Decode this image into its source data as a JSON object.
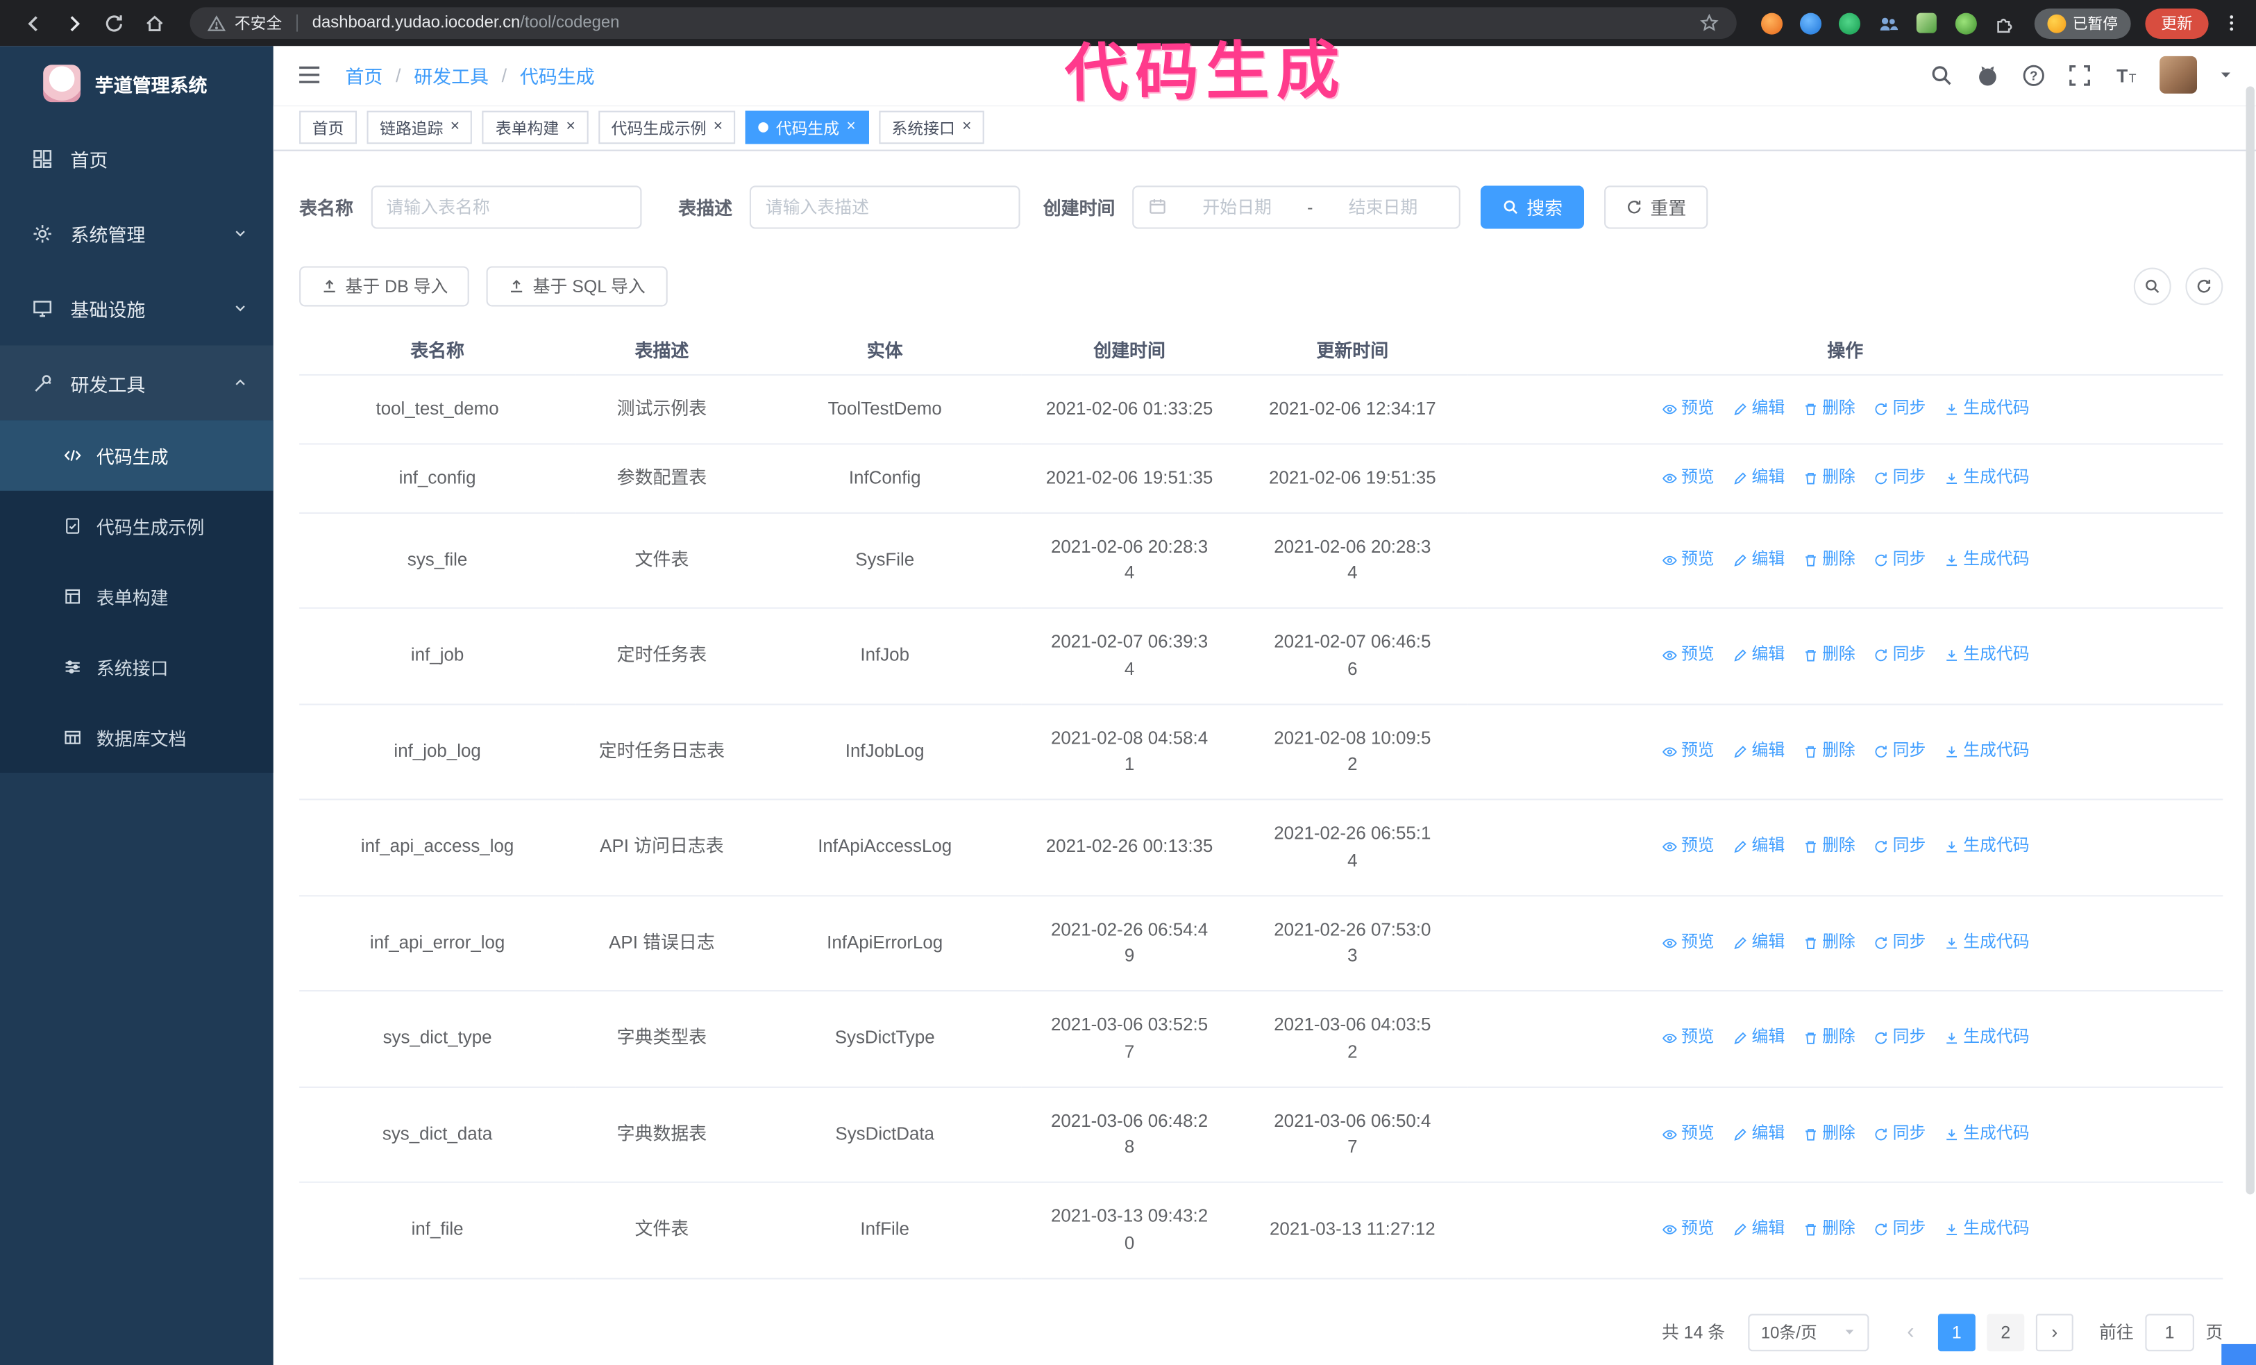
{
  "colors": {
    "accent": "#409eff",
    "annotation": "#ff3a8c",
    "sidebar_bg": "#1f3a55",
    "chrome_bg": "#202124"
  },
  "browser": {
    "security_text": "不安全",
    "url_host": "dashboard.yudao.iocoder.cn",
    "url_path": "/tool/codegen",
    "paused_badge": "已暂停",
    "update_button": "更新"
  },
  "annotation": {
    "text": "代码生成"
  },
  "sidebar": {
    "logo_title": "芋道管理系统",
    "items": [
      {
        "label": "首页"
      },
      {
        "label": "系统管理"
      },
      {
        "label": "基础设施"
      },
      {
        "label": "研发工具"
      }
    ],
    "subitems": [
      {
        "label": "代码生成"
      },
      {
        "label": "代码生成示例"
      },
      {
        "label": "表单构建"
      },
      {
        "label": "系统接口"
      },
      {
        "label": "数据库文档"
      }
    ]
  },
  "header": {
    "breadcrumb": [
      "首页",
      "研发工具",
      "代码生成"
    ]
  },
  "tabs": [
    {
      "label": "首页"
    },
    {
      "label": "链路追踪"
    },
    {
      "label": "表单构建"
    },
    {
      "label": "代码生成示例"
    },
    {
      "label": "代码生成"
    },
    {
      "label": "系统接口"
    }
  ],
  "filters": {
    "table_name_label": "表名称",
    "table_name_placeholder": "请输入表名称",
    "table_desc_label": "表描述",
    "table_desc_placeholder": "请输入表描述",
    "create_time_label": "创建时间",
    "date_start_placeholder": "开始日期",
    "date_separator": "-",
    "date_end_placeholder": "结束日期",
    "search_button": "搜索",
    "reset_button": "重置"
  },
  "toolbar": {
    "import_db": "基于 DB 导入",
    "import_sql": "基于 SQL 导入"
  },
  "table": {
    "columns": [
      "表名称",
      "表描述",
      "实体",
      "创建时间",
      "更新时间",
      "操作"
    ],
    "actions": [
      "预览",
      "编辑",
      "删除",
      "同步",
      "生成代码"
    ],
    "rows": [
      {
        "name": "tool_test_demo",
        "desc": "测试示例表",
        "entity": "ToolTestDemo",
        "created": "2021-02-06 01:33:25",
        "updated": "2021-02-06 12:34:17"
      },
      {
        "name": "inf_config",
        "desc": "参数配置表",
        "entity": "InfConfig",
        "created": "2021-02-06 19:51:35",
        "updated": "2021-02-06 19:51:35"
      },
      {
        "name": "sys_file",
        "desc": "文件表",
        "entity": "SysFile",
        "created": "2021-02-06 20:28:3\n4",
        "updated": "2021-02-06 20:28:3\n4"
      },
      {
        "name": "inf_job",
        "desc": "定时任务表",
        "entity": "InfJob",
        "created": "2021-02-07 06:39:3\n4",
        "updated": "2021-02-07 06:46:5\n6"
      },
      {
        "name": "inf_job_log",
        "desc": "定时任务日志表",
        "entity": "InfJobLog",
        "created": "2021-02-08 04:58:4\n1",
        "updated": "2021-02-08 10:09:5\n2"
      },
      {
        "name": "inf_api_access_log",
        "desc": "API 访问日志表",
        "entity": "InfApiAccessLog",
        "created": "2021-02-26 00:13:35",
        "updated": "2021-02-26 06:55:1\n4"
      },
      {
        "name": "inf_api_error_log",
        "desc": "API 错误日志",
        "entity": "InfApiErrorLog",
        "created": "2021-02-26 06:54:4\n9",
        "updated": "2021-02-26 07:53:0\n3"
      },
      {
        "name": "sys_dict_type",
        "desc": "字典类型表",
        "entity": "SysDictType",
        "created": "2021-03-06 03:52:5\n7",
        "updated": "2021-03-06 04:03:5\n2"
      },
      {
        "name": "sys_dict_data",
        "desc": "字典数据表",
        "entity": "SysDictData",
        "created": "2021-03-06 06:48:2\n8",
        "updated": "2021-03-06 06:50:4\n7"
      },
      {
        "name": "inf_file",
        "desc": "文件表",
        "entity": "InfFile",
        "created": "2021-03-13 09:43:2\n0",
        "updated": "2021-03-13 11:27:12"
      }
    ]
  },
  "pagination": {
    "total": "共 14 条",
    "page_size": "10条/页",
    "pages": [
      "1",
      "2"
    ],
    "goto_label": "前往",
    "goto_value": "1",
    "goto_suffix": "页"
  }
}
